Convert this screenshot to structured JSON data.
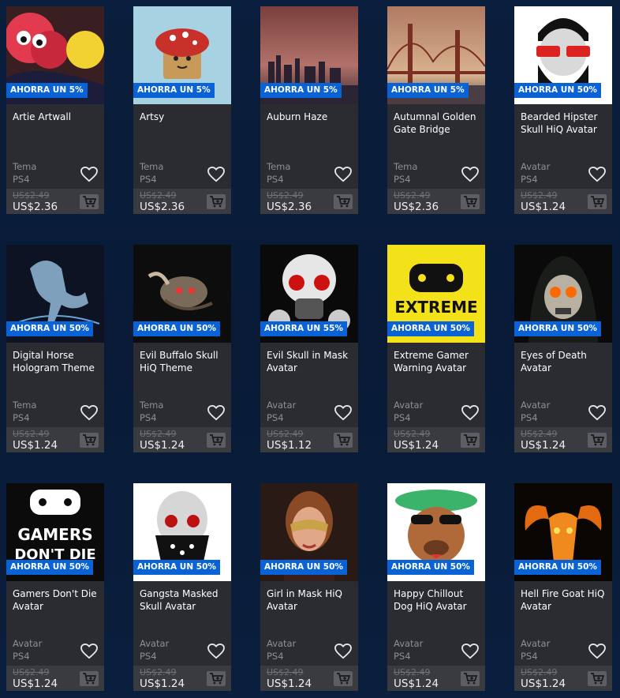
{
  "products": [
    {
      "title": "Artie Artwall",
      "badge": "AHORRA UN 5%",
      "type": "Tema",
      "platform": "PS4",
      "old_price": "US$2.49",
      "new_price": "US$2.36",
      "thumb": "artie"
    },
    {
      "title": "Artsy",
      "badge": "AHORRA UN 5%",
      "type": "Tema",
      "platform": "PS4",
      "old_price": "US$2.49",
      "new_price": "US$2.36",
      "thumb": "artsy"
    },
    {
      "title": "Auburn Haze",
      "badge": "AHORRA UN 5%",
      "type": "Tema",
      "platform": "PS4",
      "old_price": "US$2.49",
      "new_price": "US$2.36",
      "thumb": "auburn"
    },
    {
      "title": "Autumnal Golden Gate Bridge",
      "badge": "AHORRA UN 5%",
      "type": "Tema",
      "platform": "PS4",
      "old_price": "US$2.49",
      "new_price": "US$2.36",
      "thumb": "bridge"
    },
    {
      "title": "Bearded Hipster Skull HiQ Avatar",
      "badge": "AHORRA UN 50%",
      "type": "Avatar",
      "platform": "PS4",
      "old_price": "US$2.49",
      "new_price": "US$1.24",
      "thumb": "hipster"
    },
    {
      "title": "Digital Horse Hologram Theme",
      "badge": "AHORRA UN 50%",
      "type": "Tema",
      "platform": "PS4",
      "old_price": "US$2.49",
      "new_price": "US$1.24",
      "thumb": "horse"
    },
    {
      "title": "Evil Buffalo Skull HiQ Theme",
      "badge": "AHORRA UN 50%",
      "type": "Tema",
      "platform": "PS4",
      "old_price": "US$2.49",
      "new_price": "US$1.24",
      "thumb": "buffalo"
    },
    {
      "title": "Evil Skull in Mask Avatar",
      "badge": "AHORRA UN 55%",
      "type": "Avatar",
      "platform": "PS4",
      "old_price": "US$2.49",
      "new_price": "US$1.12",
      "thumb": "gasmask"
    },
    {
      "title": "Extreme Gamer Warning Avatar",
      "badge": "AHORRA UN 50%",
      "type": "Avatar",
      "platform": "PS4",
      "old_price": "US$2.49",
      "new_price": "US$1.24",
      "thumb": "extreme",
      "thumb_text": "EXTREME"
    },
    {
      "title": "Eyes of Death Avatar",
      "badge": "AHORRA UN 50%",
      "type": "Avatar",
      "platform": "PS4",
      "old_price": "US$2.49",
      "new_price": "US$1.24",
      "thumb": "reaper"
    },
    {
      "title": "Gamers Don't Die Avatar",
      "badge": "AHORRA UN 50%",
      "type": "Avatar",
      "platform": "PS4",
      "old_price": "US$2.49",
      "new_price": "US$1.24",
      "thumb": "gamers",
      "thumb_text": "GAMERS",
      "thumb_text2": "DON'T DIE"
    },
    {
      "title": "Gangsta Masked Skull Avatar",
      "badge": "AHORRA UN 50%",
      "type": "Avatar",
      "platform": "PS4",
      "old_price": "US$2.49",
      "new_price": "US$1.24",
      "thumb": "gangsta"
    },
    {
      "title": "Girl in Mask HiQ Avatar",
      "badge": "AHORRA UN 50%",
      "type": "Avatar",
      "platform": "PS4",
      "old_price": "US$2.49",
      "new_price": "US$1.24",
      "thumb": "girl"
    },
    {
      "title": "Happy Chillout Dog HiQ Avatar",
      "badge": "AHORRA UN 50%",
      "type": "Avatar",
      "platform": "PS4",
      "old_price": "US$2.49",
      "new_price": "US$1.24",
      "thumb": "dog"
    },
    {
      "title": "Hell Fire Goat HiQ Avatar",
      "badge": "AHORRA UN 50%",
      "type": "Avatar",
      "platform": "PS4",
      "old_price": "US$2.49",
      "new_price": "US$1.24",
      "thumb": "goat"
    }
  ],
  "icons": {
    "wishlist": "heart-outline-icon",
    "cart": "add-to-cart-icon"
  },
  "colors": {
    "badge": "#0a63d6",
    "card": "#2b2c31",
    "price_bar": "#3a3b40",
    "background": "#0a1e3d"
  }
}
